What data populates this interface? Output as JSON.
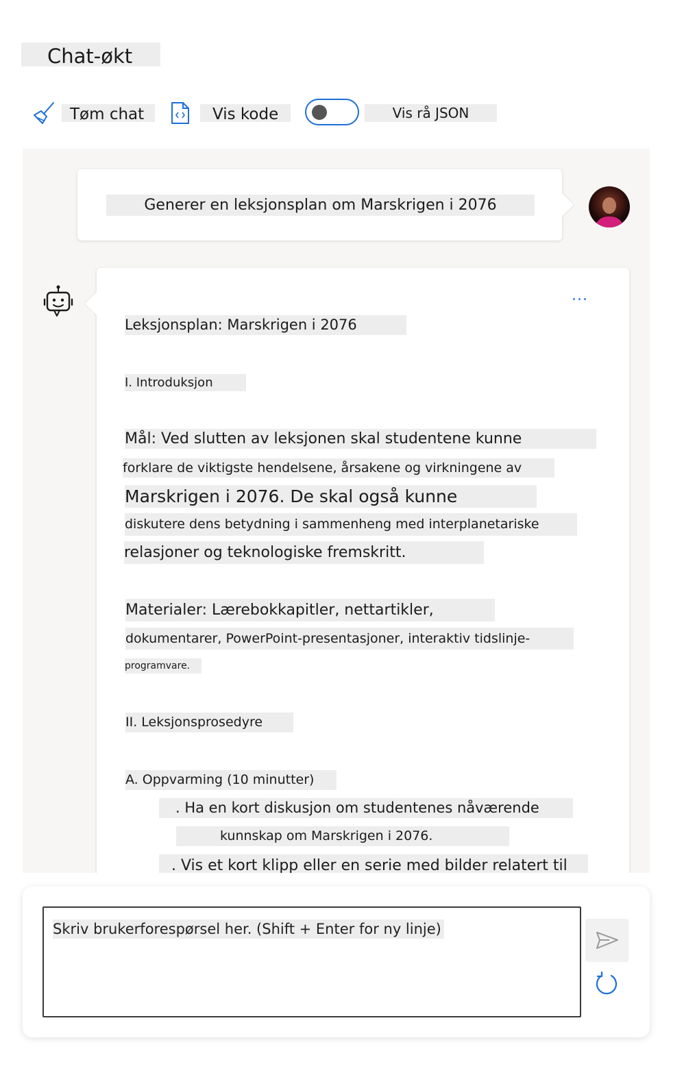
{
  "header": {
    "title": "Chat-økt"
  },
  "toolbar": {
    "clear_label": "Tøm chat",
    "code_label": "Vis kode",
    "raw_json_label": "Vis rå JSON",
    "raw_json_toggle_on": false
  },
  "conversation": {
    "user_message": "Generer en leksjonsplan om Marskrigen i 2076",
    "assistant": {
      "more_label": "...",
      "lines": [
        "Leksjonsplan: Marskrigen i 2076",
        "I. Introduksjon",
        "Mål: Ved slutten av leksjonen skal studentene kunne",
        "forklare de viktigste hendelsene, årsakene og virkningene av",
        "Marskrigen i 2076. De skal også kunne",
        "diskutere dens betydning i sammenheng med interplanetariske",
        "relasjoner og teknologiske fremskritt.",
        "Materialer: Lærebokkapitler, nettartikler,",
        "dokumentarer, PowerPoint-presentasjoner, interaktiv tidslinje-",
        "programvare.",
        "II. Leksjonsprosedyre",
        "A. Oppvarming (10 minutter)",
        ". Ha en kort diskusjon om studentenes nåværende",
        "kunnskap om Marskrigen i 2076.",
        ". Vis et kort klipp eller en serie med bilder relatert til"
      ]
    }
  },
  "composer": {
    "placeholder": "Skriv brukerforespørsel her. (Shift + Enter for ny linje)"
  },
  "colors": {
    "accent": "#1e6fd9",
    "chat_background": "#f7f6f5",
    "text_highlight": "#ededed"
  }
}
